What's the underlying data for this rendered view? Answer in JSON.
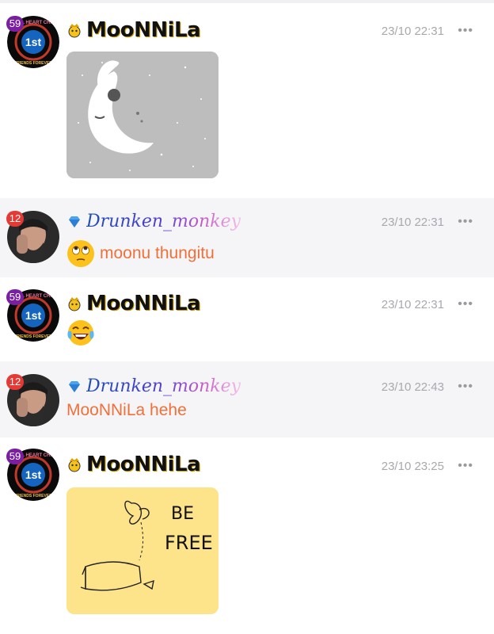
{
  "messages": [
    {
      "user": "MooNNiLa",
      "level": "59",
      "time": "23/10 22:31",
      "more": "•••",
      "type": "image",
      "image": "moon-sleeping-image"
    },
    {
      "user": "Drunken_monkey",
      "level": "12",
      "time": "23/10 22:31",
      "more": "•••",
      "type": "text",
      "emoji": "eye-roll-emoji",
      "text": "moonu thungitu"
    },
    {
      "user": "MooNNiLa",
      "level": "59",
      "time": "23/10 22:31",
      "more": "•••",
      "type": "emoji",
      "emoji": "laughing-tears-emoji"
    },
    {
      "user": "Drunken_monkey",
      "level": "12",
      "time": "23/10 22:43",
      "more": "•••",
      "type": "text",
      "text": "MooNNiLa hehe"
    },
    {
      "user": "MooNNiLa",
      "level": "59",
      "time": "23/10 23:25",
      "more": "•••",
      "type": "image",
      "image": "be-free-butterfly-image",
      "image_text": [
        "BE",
        "FREE"
      ]
    }
  ],
  "avatar_logo": {
    "ring_text_top": "TAMIL HEART CHAT",
    "ring_text_bottom": "FRIENDS FOREVER",
    "center": "1st"
  },
  "colors": {
    "message_text": "#f0703a",
    "timestamp": "#a8a8ae",
    "level_badge_purple": "#7b1fa2",
    "level_badge_red": "#e53935",
    "alt_row_bg": "#f5f5f7"
  }
}
